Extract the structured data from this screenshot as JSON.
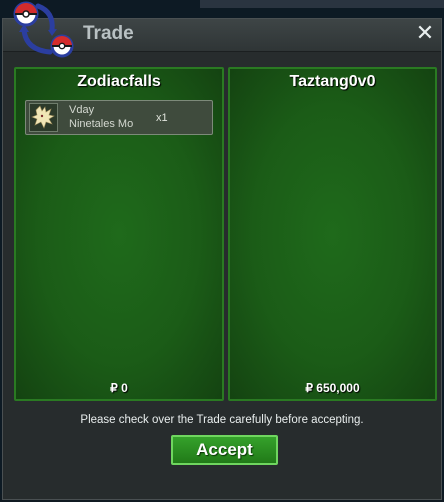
{
  "window": {
    "title": "Trade",
    "close_label": "✕"
  },
  "trade": {
    "left": {
      "player": "Zodiacfalls",
      "items": [
        {
          "line1": "Vday",
          "line2": "Ninetales Mo",
          "qty": "x1",
          "icon": "ninetales-sprite-icon"
        }
      ],
      "money": "₽ 0"
    },
    "right": {
      "player": "Taztang0v0",
      "items": [],
      "money": "₽ 650,000"
    }
  },
  "notice": "Please check over the Trade carefully before accepting.",
  "accept_label": "Accept",
  "colors": {
    "panel_green": "#1b5c17",
    "panel_border": "#2a7a22",
    "accept_green": "#2c8f22",
    "window_bg": "#272c2d"
  }
}
